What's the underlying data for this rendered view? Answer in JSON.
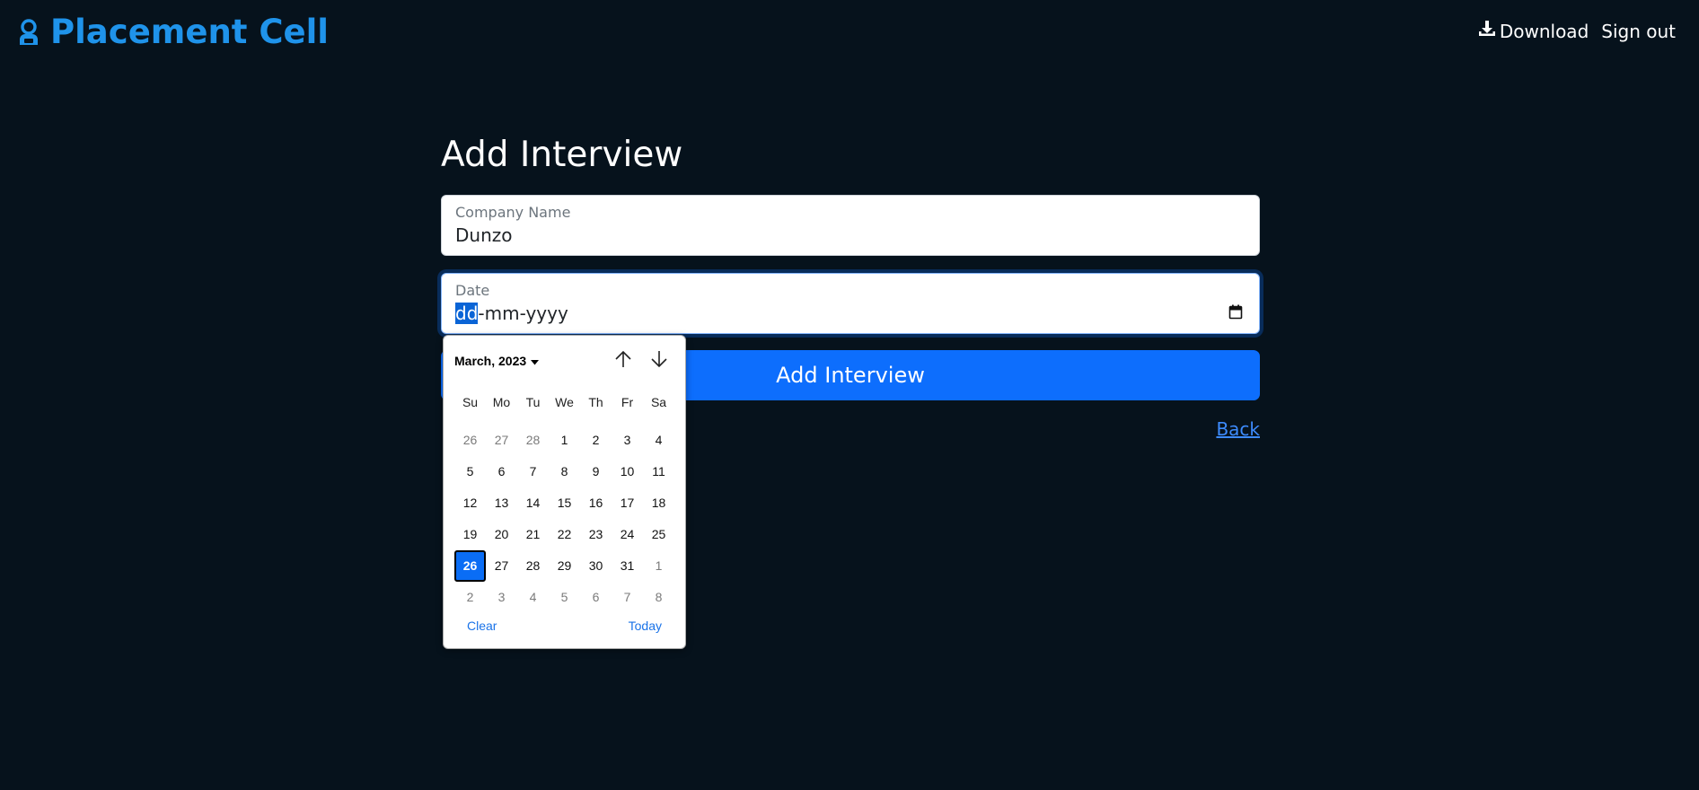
{
  "header": {
    "brand": "Placement Cell",
    "brand_color": "#1f93ea",
    "brand_icon": "user-robot-icon",
    "download_label": "Download",
    "download_icon": "download-icon",
    "signout_label": "Sign out"
  },
  "form": {
    "title": "Add Interview",
    "company": {
      "label": "Company Name",
      "value": "Dunzo"
    },
    "date": {
      "label": "Date",
      "day": "dd",
      "rest": "-mm-yyyy",
      "icon": "calendar-icon"
    },
    "submit_label": "Add Interview",
    "back_label": "Back"
  },
  "datepicker": {
    "month_label": "March, 2023",
    "weekdays": [
      "Su",
      "Mo",
      "Tu",
      "We",
      "Th",
      "Fr",
      "Sa"
    ],
    "days": [
      [
        "26",
        "27",
        "28",
        "1",
        "2",
        "3",
        "4"
      ],
      [
        "5",
        "6",
        "7",
        "8",
        "9",
        "10",
        "11"
      ],
      [
        "12",
        "13",
        "14",
        "15",
        "16",
        "17",
        "18"
      ],
      [
        "19",
        "20",
        "21",
        "22",
        "23",
        "24",
        "25"
      ],
      [
        "26",
        "27",
        "28",
        "29",
        "30",
        "31",
        "1"
      ],
      [
        "2",
        "3",
        "4",
        "5",
        "6",
        "7",
        "8"
      ]
    ],
    "muted": [
      [
        true,
        true,
        true,
        false,
        false,
        false,
        false
      ],
      [
        false,
        false,
        false,
        false,
        false,
        false,
        false
      ],
      [
        false,
        false,
        false,
        false,
        false,
        false,
        false
      ],
      [
        false,
        false,
        false,
        false,
        false,
        false,
        false
      ],
      [
        false,
        false,
        false,
        false,
        false,
        false,
        true
      ],
      [
        true,
        true,
        true,
        true,
        true,
        true,
        true
      ]
    ],
    "selected": {
      "row": 4,
      "col": 0
    },
    "clear_label": "Clear",
    "today_label": "Today"
  }
}
